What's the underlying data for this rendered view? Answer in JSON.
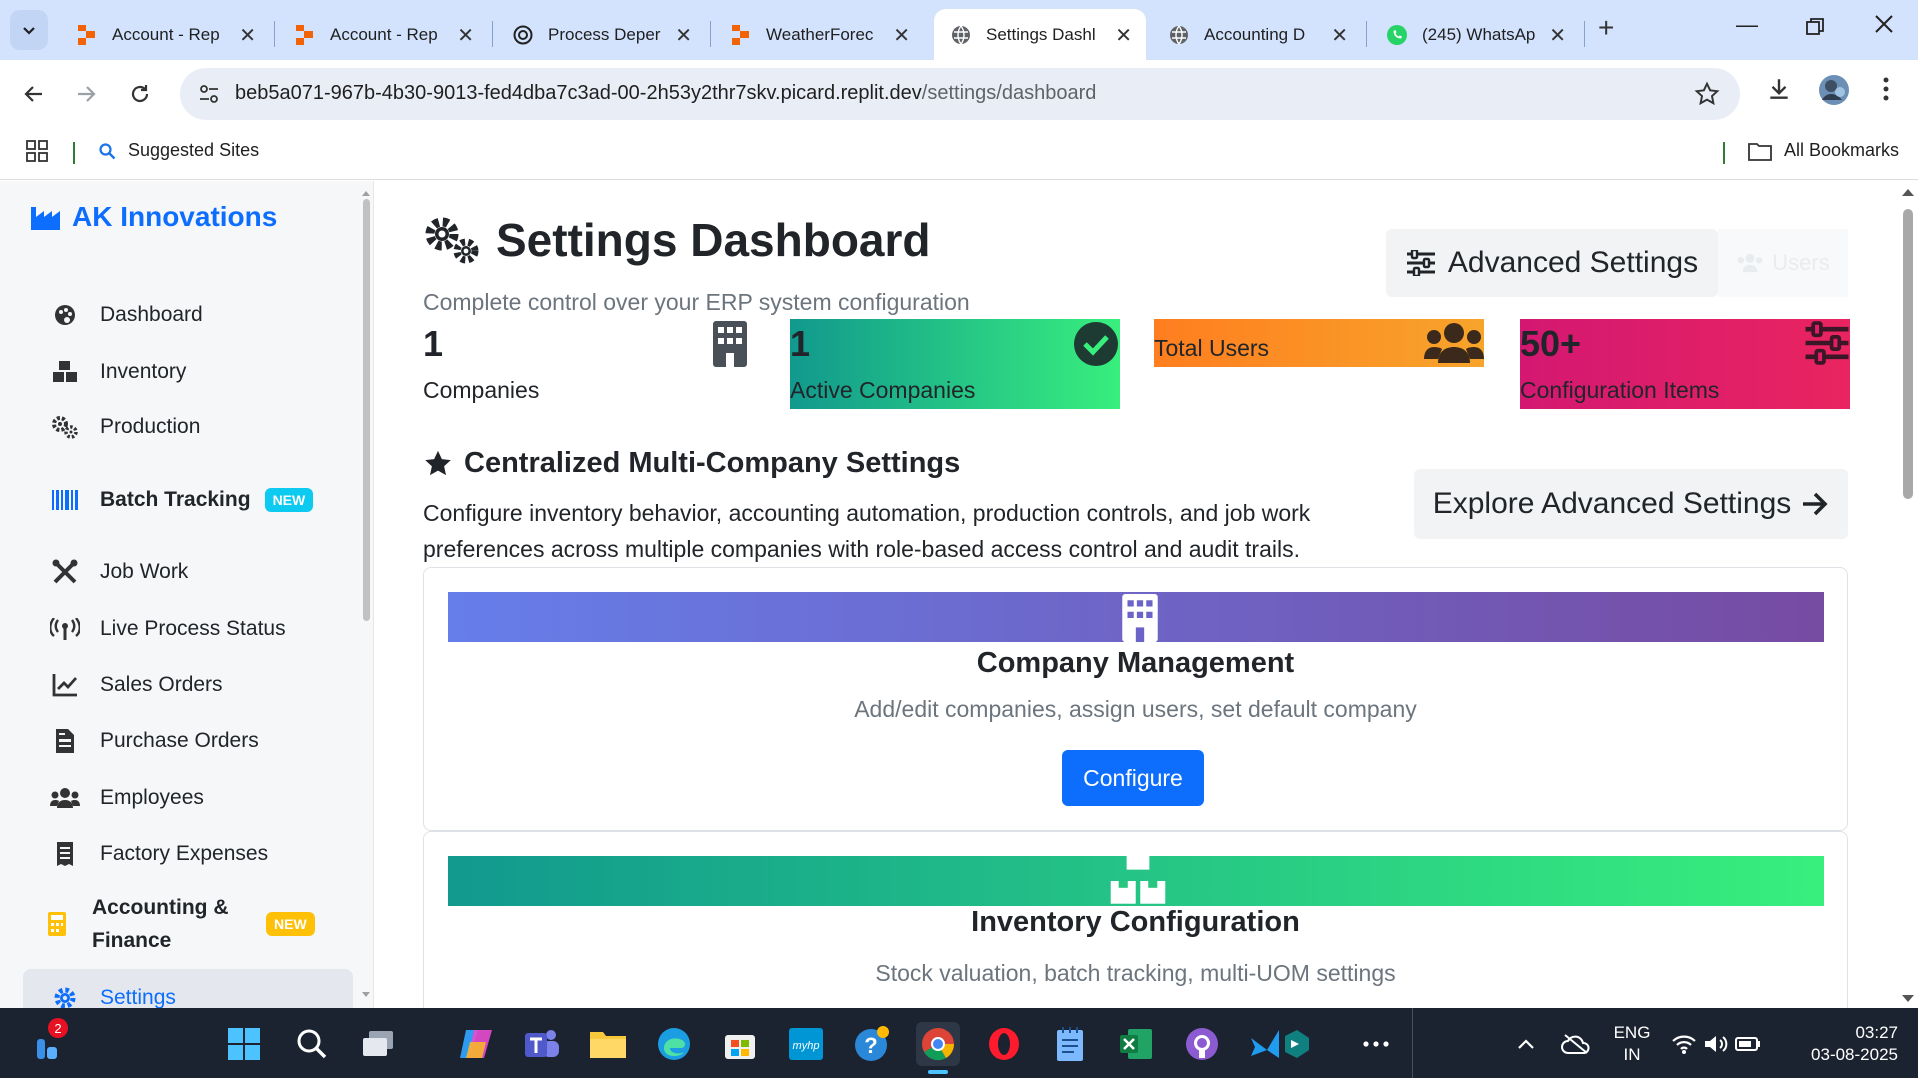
{
  "browser": {
    "tabs": [
      {
        "title": "Account - Rep",
        "icon": "replit-icon",
        "active": false
      },
      {
        "title": "Account - Rep",
        "icon": "replit-icon",
        "active": false
      },
      {
        "title": "Process Deper",
        "icon": "chatgpt-icon",
        "active": false
      },
      {
        "title": "WeatherForec",
        "icon": "replit-icon",
        "active": false
      },
      {
        "title": "Settings Dashl",
        "icon": "globe-icon",
        "active": true
      },
      {
        "title": "Accounting D",
        "icon": "globe-icon",
        "active": false
      },
      {
        "title": "(245) WhatsAp",
        "icon": "whatsapp-icon",
        "active": false
      }
    ],
    "url_host": "beb5a071-967b-4b30-9013-fed4dba7c3ad-00-2h53y2thr7skv.picard.replit.dev",
    "url_path": "/settings/dashboard",
    "bookmarks": {
      "suggested": "Suggested Sites",
      "all": "All Bookmarks"
    }
  },
  "sidebar": {
    "brand": "AK Innovations",
    "items": [
      {
        "label": "Dashboard",
        "icon": "palette-icon"
      },
      {
        "label": "Inventory",
        "icon": "boxes-icon"
      },
      {
        "label": "Production",
        "icon": "cogs-icon"
      },
      {
        "label": "Batch Tracking",
        "icon": "barcode-icon",
        "badge": "NEW"
      },
      {
        "label": "Job Work",
        "icon": "tools-icon"
      },
      {
        "label": "Live Process Status",
        "icon": "broadcast-icon"
      },
      {
        "label": "Sales Orders",
        "icon": "chart-line-icon"
      },
      {
        "label": "Purchase Orders",
        "icon": "file-invoice-icon"
      },
      {
        "label": "Employees",
        "icon": "users-icon"
      },
      {
        "label": "Factory Expenses",
        "icon": "receipt-icon"
      },
      {
        "label": "Accounting &",
        "label2": "Finance",
        "icon": "calculator-icon",
        "badge": "NEW"
      },
      {
        "label": "Settings",
        "icon": "gear-icon",
        "active": true
      }
    ]
  },
  "main": {
    "title": "Settings Dashboard",
    "subtitle": "Complete control over your ERP system configuration",
    "advanced_button": "Advanced Settings",
    "users_button": "Users",
    "stats": [
      {
        "value": "1",
        "label": "Companies",
        "icon": "building-icon"
      },
      {
        "value": "1",
        "label": "Active Companies",
        "icon": "check-circle-icon"
      },
      {
        "value": "",
        "label": "Total Users",
        "icon": "users-icon"
      },
      {
        "value": "50+",
        "label": "Configuration Items",
        "icon": "sliders-icon"
      }
    ],
    "section_title": "Centralized Multi-Company Settings",
    "section_desc": "Configure inventory behavior, accounting automation, production controls, and job work preferences across multiple companies with role-based access control and audit trails.",
    "explore_button": "Explore Advanced Settings",
    "cards": [
      {
        "title": "Company Management",
        "desc": "Add/edit companies, assign users, set default company",
        "button": "Configure",
        "icon": "building-icon"
      },
      {
        "title": "Inventory Configuration",
        "desc": "Stock valuation, batch tracking, multi-UOM settings",
        "icon": "boxes-icon"
      }
    ]
  },
  "colors": {
    "primary": "#0d6efd",
    "card1_gradient": [
      "#667eea",
      "#764ba2"
    ],
    "card2_gradient": [
      "#11998e",
      "#38ef7d"
    ],
    "stat_orange": [
      "#ff7e1f",
      "#f7a42b"
    ],
    "stat_pink": [
      "#d41872",
      "#e92460"
    ]
  },
  "taskbar": {
    "notification_count": "2",
    "lang": "ENG",
    "region": "IN",
    "time": "03:27",
    "date": "03-08-2025"
  }
}
